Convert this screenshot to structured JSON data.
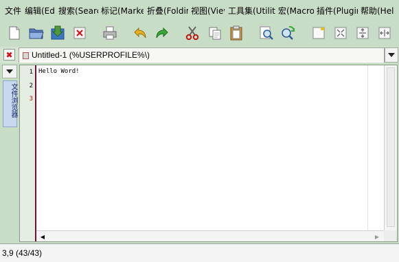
{
  "menu": [
    {
      "label": "文件"
    },
    {
      "label": "编辑(Ed"
    },
    {
      "label": "搜索(Searc"
    },
    {
      "label": "标记(Marke"
    },
    {
      "label": "折叠(Foldir"
    },
    {
      "label": "视图(View"
    },
    {
      "label": "工具集(Utiliti"
    },
    {
      "label": "宏(Macro"
    },
    {
      "label": "插件(Plugir"
    },
    {
      "label": "帮助(Hel"
    }
  ],
  "toolbar": [
    {
      "icon": "new-file-icon"
    },
    {
      "icon": "open-folder-icon"
    },
    {
      "icon": "save-icon"
    },
    {
      "icon": "close-file-icon"
    },
    {
      "icon": "print-icon"
    },
    {
      "icon": "undo-icon"
    },
    {
      "icon": "redo-icon"
    },
    {
      "icon": "cut-icon"
    },
    {
      "icon": "copy-icon"
    },
    {
      "icon": "paste-icon"
    },
    {
      "icon": "find-icon"
    },
    {
      "icon": "find-replace-icon"
    },
    {
      "icon": "unsplit-icon"
    },
    {
      "icon": "split-horizontal-icon"
    },
    {
      "icon": "split-vertical-icon"
    },
    {
      "icon": "split-side-icon"
    }
  ],
  "tab": {
    "title": "Untitled-1 (%USERPROFILE%\\)"
  },
  "dock": {
    "label": "文件浏览器"
  },
  "editor": {
    "line_numbers": [
      "1",
      "2",
      "3"
    ],
    "content": "Hello Word!"
  },
  "status": {
    "caret": "3,9 (43/43)"
  },
  "colors": {
    "background": "#c8ddc6",
    "gutter_bar": "#7a1030",
    "close_red": "#d01010"
  }
}
